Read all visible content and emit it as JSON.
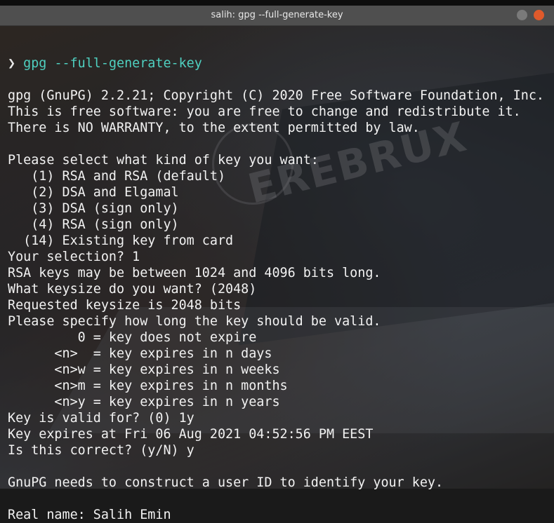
{
  "window": {
    "title": "salih: gpg --full-generate-key",
    "accent_close": "#e05a2b"
  },
  "watermark": "EREBRUX",
  "terminal": {
    "prompt_symbol": "❯",
    "command": "gpg --full-generate-key",
    "lines": [
      "gpg (GnuPG) 2.2.21; Copyright (C) 2020 Free Software Foundation, Inc.",
      "This is free software: you are free to change and redistribute it.",
      "There is NO WARRANTY, to the extent permitted by law.",
      "",
      "Please select what kind of key you want:",
      "   (1) RSA and RSA (default)",
      "   (2) DSA and Elgamal",
      "   (3) DSA (sign only)",
      "   (4) RSA (sign only)",
      "  (14) Existing key from card",
      "Your selection? 1",
      "RSA keys may be between 1024 and 4096 bits long.",
      "What keysize do you want? (2048)",
      "Requested keysize is 2048 bits",
      "Please specify how long the key should be valid.",
      "         0 = key does not expire",
      "      <n>  = key expires in n days",
      "      <n>w = key expires in n weeks",
      "      <n>m = key expires in n months",
      "      <n>y = key expires in n years",
      "Key is valid for? (0) 1y",
      "Key expires at Fri 06 Aug 2021 04:52:56 PM EEST",
      "Is this correct? (y/N) y",
      "",
      "GnuPG needs to construct a user ID to identify your key.",
      "",
      "Real name: Salih Emin"
    ]
  }
}
